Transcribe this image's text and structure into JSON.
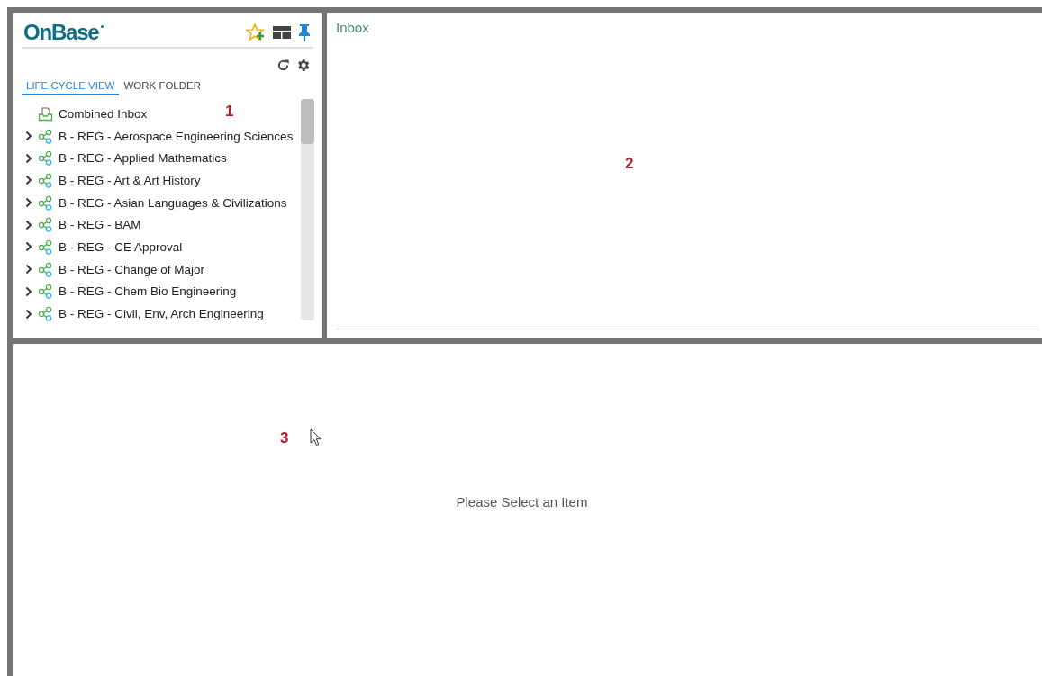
{
  "logo": "OnBase",
  "tabs": [
    {
      "label": "LIFE CYCLE VIEW",
      "selected": true
    },
    {
      "label": "WORK FOLDER",
      "selected": false
    }
  ],
  "tree": [
    {
      "kind": "inbox",
      "label": "Combined Inbox"
    },
    {
      "kind": "lifecycle",
      "label": "B - REG - Aerospace Engineering Sciences",
      "expanded": false
    },
    {
      "kind": "lifecycle",
      "label": "B - REG - Applied Mathematics",
      "expanded": false
    },
    {
      "kind": "lifecycle",
      "label": "B - REG - Art & Art History",
      "expanded": false
    },
    {
      "kind": "lifecycle",
      "label": "B - REG - Asian Languages & Civilizations",
      "expanded": false
    },
    {
      "kind": "lifecycle",
      "label": "B - REG - BAM",
      "expanded": false
    },
    {
      "kind": "lifecycle",
      "label": "B - REG - CE Approval",
      "expanded": false
    },
    {
      "kind": "lifecycle",
      "label": "B - REG - Change of Major",
      "expanded": false
    },
    {
      "kind": "lifecycle",
      "label": "B - REG - Chem Bio Engineering",
      "expanded": false
    },
    {
      "kind": "lifecycle",
      "label": "B - REG - Civil, Env, Arch Engineering",
      "expanded": false
    }
  ],
  "annotations": [
    "1",
    "2",
    "3"
  ],
  "inbox_panel": {
    "title": "Inbox"
  },
  "viewer_panel": {
    "message": "Please Select an Item"
  }
}
